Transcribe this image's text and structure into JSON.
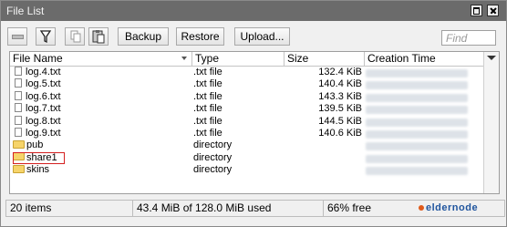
{
  "window": {
    "title": "File List"
  },
  "toolbar": {
    "backup_label": "Backup",
    "restore_label": "Restore",
    "upload_label": "Upload...",
    "find_placeholder": "Find"
  },
  "table": {
    "columns": [
      "File Name",
      "Type",
      "Size",
      "Creation Time"
    ],
    "rows": [
      {
        "name": "log.4.txt",
        "type": ".txt file",
        "size": "132.4 KiB",
        "icon": "file-icon"
      },
      {
        "name": "log.5.txt",
        "type": ".txt file",
        "size": "140.4 KiB",
        "icon": "file-icon"
      },
      {
        "name": "log.6.txt",
        "type": ".txt file",
        "size": "143.3 KiB",
        "icon": "file-icon"
      },
      {
        "name": "log.7.txt",
        "type": ".txt file",
        "size": "139.5 KiB",
        "icon": "file-icon"
      },
      {
        "name": "log.8.txt",
        "type": ".txt file",
        "size": "144.5 KiB",
        "icon": "file-icon"
      },
      {
        "name": "log.9.txt",
        "type": ".txt file",
        "size": "140.6 KiB",
        "icon": "file-icon"
      },
      {
        "name": "pub",
        "type": "directory",
        "size": "",
        "icon": "folder-icon"
      },
      {
        "name": "share1",
        "type": "directory",
        "size": "",
        "icon": "folder-icon",
        "highlighted": true
      },
      {
        "name": "skins",
        "type": "directory",
        "size": "",
        "icon": "folder-icon"
      }
    ]
  },
  "status": {
    "items": "20 items",
    "usage": "43.4 MiB of 128.0 MiB used",
    "free": "66% free"
  },
  "watermark": {
    "text": "eldernode"
  },
  "colors": {
    "titlebar": "#6b6b6b",
    "highlight": "#d42020",
    "folder": "#f6d46a",
    "watermark": "#20559e"
  }
}
